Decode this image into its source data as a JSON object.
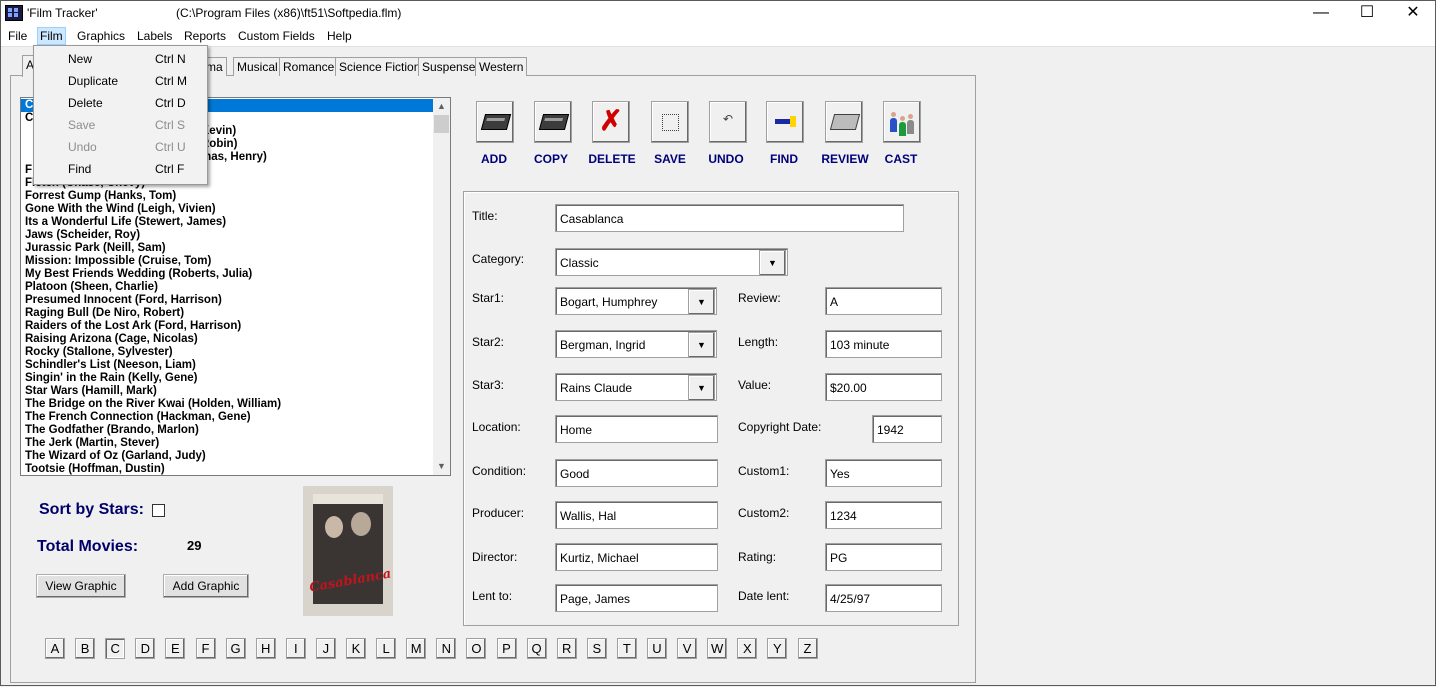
{
  "window": {
    "title": "'Film Tracker'",
    "path": "(C:\\Program Files (x86)\\ft51\\Softpedia.flm)",
    "minimize": "—",
    "maximize": "☐",
    "close": "✕"
  },
  "menu": [
    "File",
    "Film",
    "Graphics",
    "Labels",
    "Reports",
    "Custom Fields",
    "Help"
  ],
  "film_menu": [
    {
      "label": "New",
      "shortcut": "Ctrl N",
      "enabled": true
    },
    {
      "label": "Duplicate",
      "shortcut": "Ctrl M",
      "enabled": true
    },
    {
      "label": "Delete",
      "shortcut": "Ctrl D",
      "enabled": true
    },
    {
      "label": "Save",
      "shortcut": "Ctrl S",
      "enabled": false
    },
    {
      "label": "Undo",
      "shortcut": "Ctrl U",
      "enabled": false
    },
    {
      "label": "Find",
      "shortcut": "Ctrl F",
      "enabled": true
    }
  ],
  "tabs": [
    "A",
    "ma",
    "Musical",
    "Romance",
    "Science Fiction",
    "Suspense",
    "Western"
  ],
  "film_list": [
    "C",
    "C",
    "Kevin)",
    "Robin)",
    "mas, Henry)",
    "F",
    "Fletch (Chase, Chevy)",
    "Forrest Gump (Hanks, Tom)",
    "Gone With the Wind (Leigh, Vivien)",
    "Its a Wonderful Life (Stewert, James)",
    "Jaws (Scheider, Roy)",
    "Jurassic Park (Neill, Sam)",
    "Mission: Impossible (Cruise, Tom)",
    "My Best Friends Wedding (Roberts, Julia)",
    "Platoon (Sheen, Charlie)",
    "Presumed Innocent (Ford, Harrison)",
    "Raging Bull (De Niro, Robert)",
    "Raiders of the Lost Ark (Ford, Harrison)",
    "Raising Arizona (Cage, Nicolas)",
    "Rocky (Stallone, Sylvester)",
    "Schindler's List (Neeson, Liam)",
    "Singin' in the Rain (Kelly, Gene)",
    "Star Wars (Hamill, Mark)",
    "The Bridge on the River Kwai (Holden, William)",
    "The French Connection (Hackman, Gene)",
    "The Godfather (Brando, Marlon)",
    "The Jerk (Martin, Stever)",
    "The Wizard of Oz (Garland, Judy)",
    "Tootsie (Hoffman, Dustin)"
  ],
  "sort_by_stars_label": "Sort by Stars:",
  "total_movies_label": "Total Movies:",
  "total_movies_count": "29",
  "view_graphic": "View Graphic",
  "add_graphic": "Add Graphic",
  "poster_title": "Casablanca",
  "letters": [
    "A",
    "B",
    "C",
    "D",
    "E",
    "F",
    "G",
    "H",
    "I",
    "J",
    "K",
    "L",
    "M",
    "N",
    "O",
    "P",
    "Q",
    "R",
    "S",
    "T",
    "U",
    "V",
    "W",
    "X",
    "Y",
    "Z"
  ],
  "selected_letter": "C",
  "toolbar": [
    "ADD",
    "COPY",
    "DELETE",
    "SAVE",
    "UNDO",
    "FIND",
    "REVIEW",
    "CAST"
  ],
  "labels": {
    "title": "Title:",
    "category": "Category:",
    "star1": "Star1:",
    "star2": "Star2:",
    "star3": "Star3:",
    "location": "Location:",
    "condition": "Condition:",
    "producer": "Producer:",
    "director": "Director:",
    "lent_to": "Lent to:",
    "review": "Review:",
    "length": "Length:",
    "value": "Value:",
    "copyright": "Copyright Date:",
    "custom1": "Custom1:",
    "custom2": "Custom2:",
    "rating": "Rating:",
    "date_lent": "Date lent:"
  },
  "values": {
    "title": "Casablanca",
    "category": "Classic",
    "star1": "Bogart, Humphrey",
    "star2": "Bergman, Ingrid",
    "star3": "Rains Claude",
    "location": "Home",
    "condition": "Good",
    "producer": "Wallis, Hal",
    "director": "Kurtiz, Michael",
    "lent_to": "Page, James",
    "review": "A",
    "length": "103 minute",
    "value": "$20.00",
    "copyright": "1942",
    "custom1": "Yes",
    "custom2": "1234",
    "rating": "PG",
    "date_lent": "4/25/97"
  }
}
